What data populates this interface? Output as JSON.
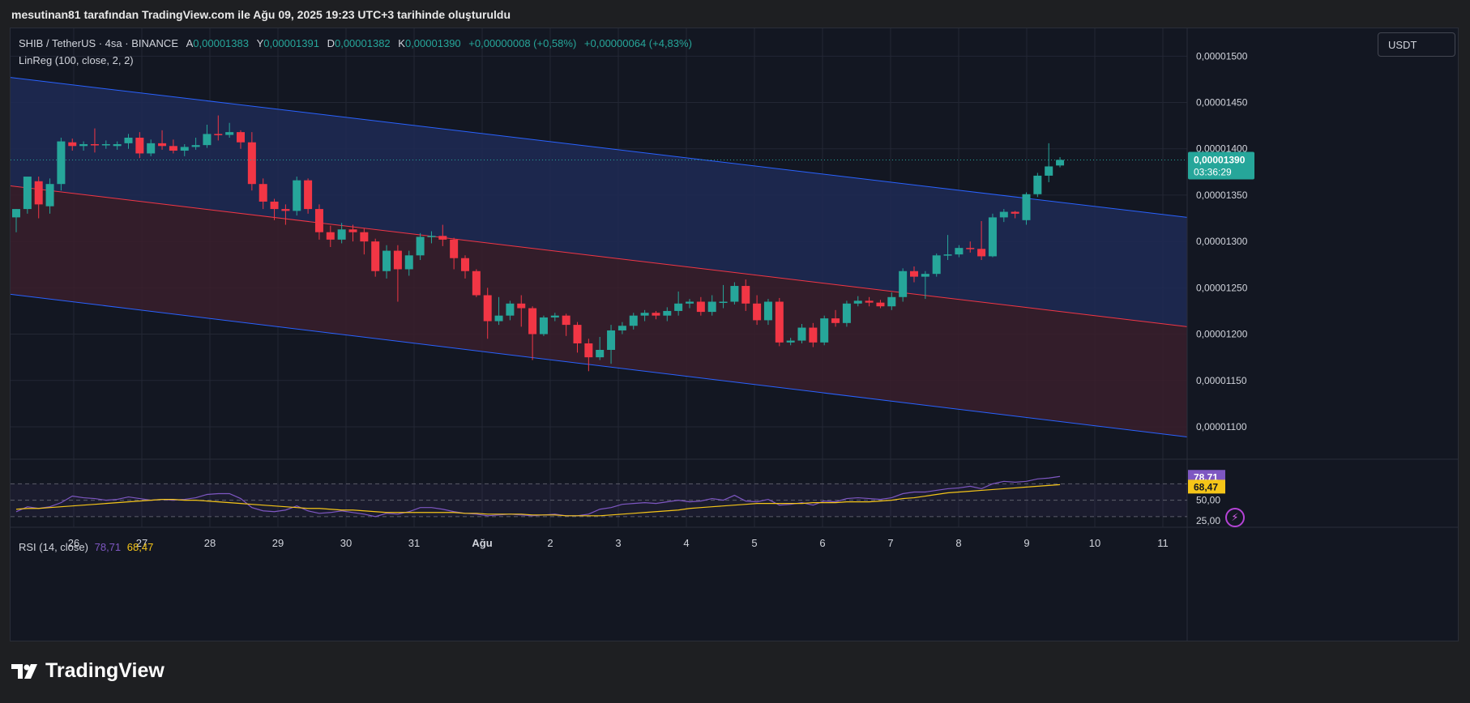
{
  "header": {
    "caption": "mesutinan81 tarafından TradingView.com ile Ağu 09, 2025 19:23 UTC+3 tarihinde oluşturuldu"
  },
  "brand": {
    "name": "TradingView"
  },
  "currency_button": "USDT",
  "legend": {
    "symbol": "SHIB / TetherUS · 4sa · BINANCE",
    "open_label": "A",
    "open": "0,00001383",
    "high_label": "Y",
    "high": "0,00001391",
    "low_label": "D",
    "low": "0,00001382",
    "close_label": "K",
    "close": "0,00001390",
    "change": "+0,00000008 (+0,58%)",
    "change2": "+0,00000064 (+4,83%)",
    "indicator": "LinReg (100, close, 2, 2)"
  },
  "rsi_legend": {
    "title": "RSI (14, close)",
    "rsi": "78,71",
    "ma": "68,47"
  },
  "colors": {
    "up": "#26a69a",
    "down": "#f23645",
    "channel_outer": "#2962ff",
    "channel_mid": "#f23645",
    "upper_fill": "#1e2a55",
    "lower_fill": "#3a1e2b",
    "rsi_line": "#7e57c2",
    "rsi_ma": "#f5c518",
    "bg": "#131722"
  },
  "chart_data": {
    "type": "candlestick",
    "symbol": "SHIB / TetherUS",
    "interval": "4sa",
    "exchange": "BINANCE",
    "ylim": [
      1.065e-05,
      1.53e-05
    ],
    "y_ticks": [
      {
        "v": 1.5e-05,
        "label": "0,00001500"
      },
      {
        "v": 1.45e-05,
        "label": "0,00001450"
      },
      {
        "v": 1.4e-05,
        "label": "0,00001400"
      },
      {
        "v": 1.35e-05,
        "label": "0,00001350"
      },
      {
        "v": 1.3e-05,
        "label": "0,00001300"
      },
      {
        "v": 1.25e-05,
        "label": "0,00001250"
      },
      {
        "v": 1.2e-05,
        "label": "0,00001200"
      },
      {
        "v": 1.15e-05,
        "label": "0,00001150"
      },
      {
        "v": 1.1e-05,
        "label": "0,00001100"
      }
    ],
    "x_ticks": [
      "26",
      "27",
      "28",
      "29",
      "30",
      "31",
      "Ağu",
      "2",
      "3",
      "4",
      "5",
      "6",
      "7",
      "8",
      "9",
      "10",
      "11"
    ],
    "price_label": "0,00001390",
    "countdown": "03:36:29",
    "channel": {
      "upper": [
        1.477e-05,
        1.326e-05
      ],
      "middle": [
        1.36e-05,
        1.208e-05
      ],
      "lower": [
        1.243e-05,
        1.089e-05
      ]
    },
    "candles": [
      [
        1.326,
        1.335,
        1.31,
        1.335
      ],
      [
        1.335,
        1.37,
        1.33,
        1.365
      ],
      [
        1.365,
        1.34,
        1.325,
        1.37
      ],
      [
        1.338,
        1.362,
        1.33,
        1.368
      ],
      [
        1.362,
        1.408,
        1.355,
        1.412
      ],
      [
        1.407,
        1.403,
        1.398,
        1.411
      ],
      [
        1.403,
        1.405,
        1.398,
        1.408
      ],
      [
        1.405,
        1.404,
        1.396,
        1.422
      ],
      [
        1.404,
        1.405,
        1.4,
        1.409
      ],
      [
        1.403,
        1.405,
        1.399,
        1.408
      ],
      [
        1.406,
        1.412,
        1.4,
        1.416
      ],
      [
        1.412,
        1.395,
        1.39,
        1.418
      ],
      [
        1.395,
        1.406,
        1.392,
        1.41
      ],
      [
        1.406,
        1.403,
        1.399,
        1.42
      ],
      [
        1.403,
        1.398,
        1.395,
        1.41
      ],
      [
        1.398,
        1.402,
        1.392,
        1.405
      ],
      [
        1.402,
        1.404,
        1.399,
        1.412
      ],
      [
        1.404,
        1.416,
        1.401,
        1.426
      ],
      [
        1.416,
        1.415,
        1.409,
        1.436
      ],
      [
        1.415,
        1.418,
        1.412,
        1.428
      ],
      [
        1.418,
        1.407,
        1.4,
        1.42
      ],
      [
        1.407,
        1.362,
        1.355,
        1.418
      ],
      [
        1.362,
        1.343,
        1.335,
        1.368
      ],
      [
        1.343,
        1.335,
        1.323,
        1.346
      ],
      [
        1.335,
        1.333,
        1.318,
        1.34
      ],
      [
        1.333,
        1.366,
        1.328,
        1.37
      ],
      [
        1.366,
        1.335,
        1.33,
        1.368
      ],
      [
        1.335,
        1.31,
        1.302,
        1.34
      ],
      [
        1.31,
        1.302,
        1.294,
        1.317
      ],
      [
        1.302,
        1.313,
        1.298,
        1.32
      ],
      [
        1.313,
        1.31,
        1.3,
        1.318
      ],
      [
        1.31,
        1.3,
        1.286,
        1.314
      ],
      [
        1.3,
        1.268,
        1.262,
        1.303
      ],
      [
        1.268,
        1.29,
        1.26,
        1.296
      ],
      [
        1.29,
        1.27,
        1.235,
        1.296
      ],
      [
        1.27,
        1.285,
        1.263,
        1.29
      ],
      [
        1.285,
        1.305,
        1.28,
        1.309
      ],
      [
        1.305,
        1.306,
        1.298,
        1.311
      ],
      [
        1.306,
        1.302,
        1.295,
        1.318
      ],
      [
        1.302,
        1.282,
        1.27,
        1.304
      ],
      [
        1.282,
        1.268,
        1.26,
        1.285
      ],
      [
        1.268,
        1.242,
        1.24,
        1.27
      ],
      [
        1.242,
        1.214,
        1.195,
        1.25
      ],
      [
        1.214,
        1.22,
        1.21,
        1.24
      ],
      [
        1.22,
        1.233,
        1.215,
        1.236
      ],
      [
        1.233,
        1.228,
        1.208,
        1.242
      ],
      [
        1.228,
        1.2,
        1.172,
        1.23
      ],
      [
        1.2,
        1.218,
        1.198,
        1.22
      ],
      [
        1.218,
        1.22,
        1.214,
        1.223
      ],
      [
        1.22,
        1.21,
        1.198,
        1.222
      ],
      [
        1.21,
        1.19,
        1.18,
        1.213
      ],
      [
        1.19,
        1.175,
        1.16,
        1.195
      ],
      [
        1.175,
        1.183,
        1.172,
        1.197
      ],
      [
        1.183,
        1.204,
        1.168,
        1.21
      ],
      [
        1.204,
        1.209,
        1.2,
        1.213
      ],
      [
        1.209,
        1.22,
        1.205,
        1.223
      ],
      [
        1.22,
        1.223,
        1.214,
        1.226
      ],
      [
        1.223,
        1.22,
        1.216,
        1.225
      ],
      [
        1.22,
        1.225,
        1.214,
        1.229
      ],
      [
        1.225,
        1.233,
        1.22,
        1.246
      ],
      [
        1.233,
        1.235,
        1.228,
        1.238
      ],
      [
        1.235,
        1.224,
        1.22,
        1.24
      ],
      [
        1.224,
        1.235,
        1.22,
        1.242
      ],
      [
        1.235,
        1.235,
        1.228,
        1.253
      ],
      [
        1.235,
        1.252,
        1.232,
        1.256
      ],
      [
        1.252,
        1.233,
        1.225,
        1.259
      ],
      [
        1.233,
        1.215,
        1.21,
        1.242
      ],
      [
        1.215,
        1.235,
        1.21,
        1.238
      ],
      [
        1.235,
        1.191,
        1.187,
        1.239
      ],
      [
        1.191,
        1.193,
        1.188,
        1.196
      ],
      [
        1.193,
        1.207,
        1.19,
        1.211
      ],
      [
        1.207,
        1.191,
        1.186,
        1.212
      ],
      [
        1.191,
        1.217,
        1.188,
        1.22
      ],
      [
        1.217,
        1.212,
        1.208,
        1.226
      ],
      [
        1.212,
        1.233,
        1.208,
        1.236
      ],
      [
        1.233,
        1.236,
        1.23,
        1.241
      ],
      [
        1.236,
        1.234,
        1.23,
        1.24
      ],
      [
        1.234,
        1.23,
        1.228,
        1.237
      ],
      [
        1.23,
        1.24,
        1.226,
        1.245
      ],
      [
        1.24,
        1.268,
        1.235,
        1.271
      ],
      [
        1.268,
        1.262,
        1.256,
        1.273
      ],
      [
        1.262,
        1.265,
        1.238,
        1.268
      ],
      [
        1.265,
        1.285,
        1.262,
        1.287
      ],
      [
        1.285,
        1.286,
        1.28,
        1.307
      ],
      [
        1.286,
        1.293,
        1.283,
        1.296
      ],
      [
        1.293,
        1.292,
        1.288,
        1.3
      ],
      [
        1.292,
        1.284,
        1.28,
        1.322
      ],
      [
        1.284,
        1.326,
        1.283,
        1.33
      ],
      [
        1.326,
        1.332,
        1.321,
        1.335
      ],
      [
        1.332,
        1.33,
        1.325,
        1.333
      ],
      [
        1.323,
        1.351,
        1.318,
        1.353
      ],
      [
        1.351,
        1.371,
        1.348,
        1.374
      ],
      [
        1.371,
        1.381,
        1.364,
        1.406
      ],
      [
        1.382,
        1.388,
        1.38,
        1.391
      ]
    ],
    "rsi": {
      "ylim": [
        17,
        100
      ],
      "levels": [
        {
          "v": 70,
          "label": ""
        },
        {
          "v": 50,
          "label": "50,00"
        },
        {
          "v": 30,
          "label": ""
        },
        {
          "v": 25,
          "label": "25,00"
        }
      ],
      "value_label": "78,71",
      "ma_label": "68,47",
      "rsi": [
        36,
        42,
        40,
        42,
        47,
        55,
        53,
        52,
        50,
        51,
        54,
        52,
        50,
        51,
        50,
        51,
        53,
        57,
        58,
        58,
        52,
        41,
        37,
        36,
        38,
        43,
        37,
        34,
        35,
        37,
        35,
        33,
        30,
        34,
        33,
        36,
        41,
        41,
        39,
        36,
        34,
        33,
        31,
        32,
        33,
        32,
        31,
        32,
        33,
        31,
        31,
        33,
        39,
        41,
        45,
        46,
        47,
        46,
        48,
        50,
        48,
        49,
        52,
        50,
        56,
        49,
        48,
        51,
        44,
        45,
        47,
        44,
        49,
        48,
        52,
        53,
        52,
        51,
        53,
        58,
        60,
        60,
        62,
        64,
        65,
        67,
        64,
        70,
        73,
        72,
        73,
        76,
        77,
        79
      ],
      "ma": [
        39,
        40,
        40,
        41,
        42,
        43,
        44,
        45,
        46,
        47,
        48,
        49,
        50,
        51,
        51,
        50,
        50,
        49,
        48,
        47,
        46,
        45,
        44,
        43,
        42,
        41,
        40,
        40,
        39,
        38,
        38,
        37,
        36,
        35,
        35,
        35,
        35,
        35,
        35,
        35,
        34,
        34,
        33,
        33,
        33,
        33,
        32,
        32,
        32,
        31,
        31,
        31,
        31,
        32,
        33,
        34,
        35,
        36,
        37,
        38,
        40,
        41,
        42,
        43,
        44,
        45,
        46,
        46,
        46,
        46,
        46,
        47,
        47,
        47,
        48,
        48,
        48,
        49,
        50,
        52,
        53,
        55,
        57,
        59,
        60,
        61,
        62,
        63,
        64,
        65,
        66,
        67,
        68,
        69
      ]
    }
  }
}
